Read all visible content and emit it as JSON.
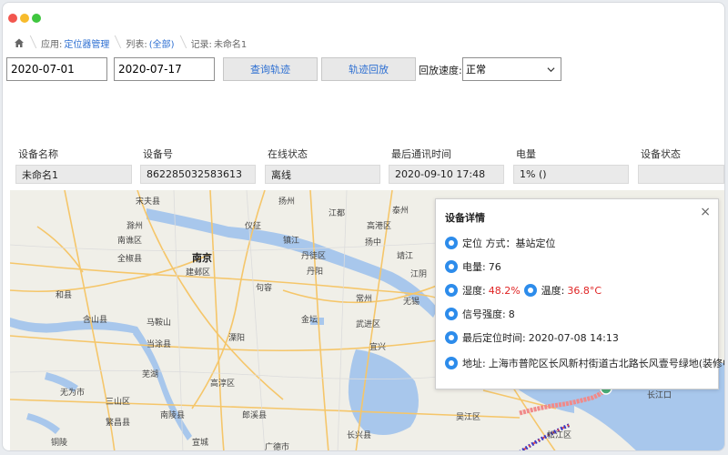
{
  "breadcrumb": {
    "app_label": "应用:",
    "app_value": "定位器管理",
    "list_label": "列表:",
    "list_value": "(全部)",
    "record_label": "记录:",
    "record_value": "未命名1"
  },
  "toolbar": {
    "start_date": "2020-07-01",
    "end_date": "2020-07-17",
    "query_button": "查询轨迹",
    "playback_button": "轨迹回放",
    "speed_label": "回放速度:",
    "speed_value": "正常"
  },
  "fields": [
    {
      "label": "设备名称",
      "value": "未命名1"
    },
    {
      "label": "设备号",
      "value": "862285032583613"
    },
    {
      "label": "在线状态",
      "value": "离线"
    },
    {
      "label": "最后通讯时间",
      "value": "2020-09-10 17:48"
    },
    {
      "label": "电量",
      "value": "1%  ()"
    },
    {
      "label": "设备状态",
      "value": ""
    }
  ],
  "map": {
    "city_labels": [
      "宋夫县",
      "扬州",
      "滁州",
      "仪征",
      "江都",
      "泰州",
      "南谯区",
      "镇江",
      "高港区",
      "全椒县",
      "南京",
      "丹徒区",
      "扬中",
      "靖江",
      "建邺区",
      "句容",
      "丹阳",
      "常州",
      "江阴",
      "和县",
      "金坛",
      "含山县",
      "马鞍山",
      "溧阳",
      "武进区",
      "无锡",
      "当涂县",
      "宜兴",
      "芜湖",
      "高淳区",
      "无为市",
      "三山区",
      "南陵县",
      "郎溪县",
      "繁昌县",
      "长兴县",
      "吴江区",
      "松江区",
      "长江口",
      "铜陵",
      "宣城",
      "广德市"
    ]
  },
  "popup": {
    "title": "设备详情",
    "close": "×",
    "locate_method_label": "定位 方式：",
    "locate_method_value": "基站定位",
    "battery_label": "电量:",
    "battery_value": "76",
    "humidity_label": "湿度:",
    "humidity_value": "48.2%",
    "temperature_label": "温度:",
    "temperature_value": "36.8°C",
    "signal_label": "信号强度:",
    "signal_value": "8",
    "last_locate_label": "最后定位时间:",
    "last_locate_value": "2020-07-08 14:13",
    "address_label": "地址:",
    "address_value": "上海市普陀区长风新村街道古北路长风壹号绿地(装修中)"
  },
  "colors": {
    "link_blue": "#2d6fd2",
    "accent_red": "#e02424",
    "icon_blue": "#2d8ceb",
    "map_water": "#a8c7ec",
    "map_road": "#f5c66a"
  }
}
